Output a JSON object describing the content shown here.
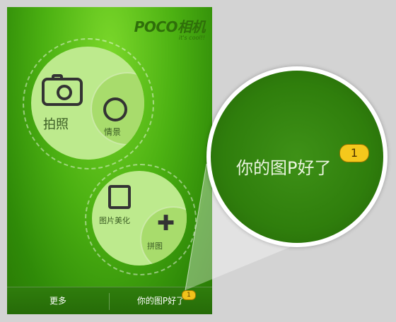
{
  "app": {
    "brand": "POCO相机",
    "tagline": "it's cool!!"
  },
  "menu": {
    "camera_label": "拍照",
    "scene_label": "情景",
    "beautify_label": "图片美化",
    "collage_label": "拼图"
  },
  "bottom_bar": {
    "more_label": "更多",
    "notification_label": "你的图P好了",
    "notification_count": "1"
  },
  "magnifier": {
    "text": "你的图P好了",
    "count": "1"
  },
  "colors": {
    "background": "#d3d3d3",
    "screen_green": "#4cb112",
    "circle_fill": "#bdea8d",
    "badge_yellow": "#f4c81c"
  }
}
